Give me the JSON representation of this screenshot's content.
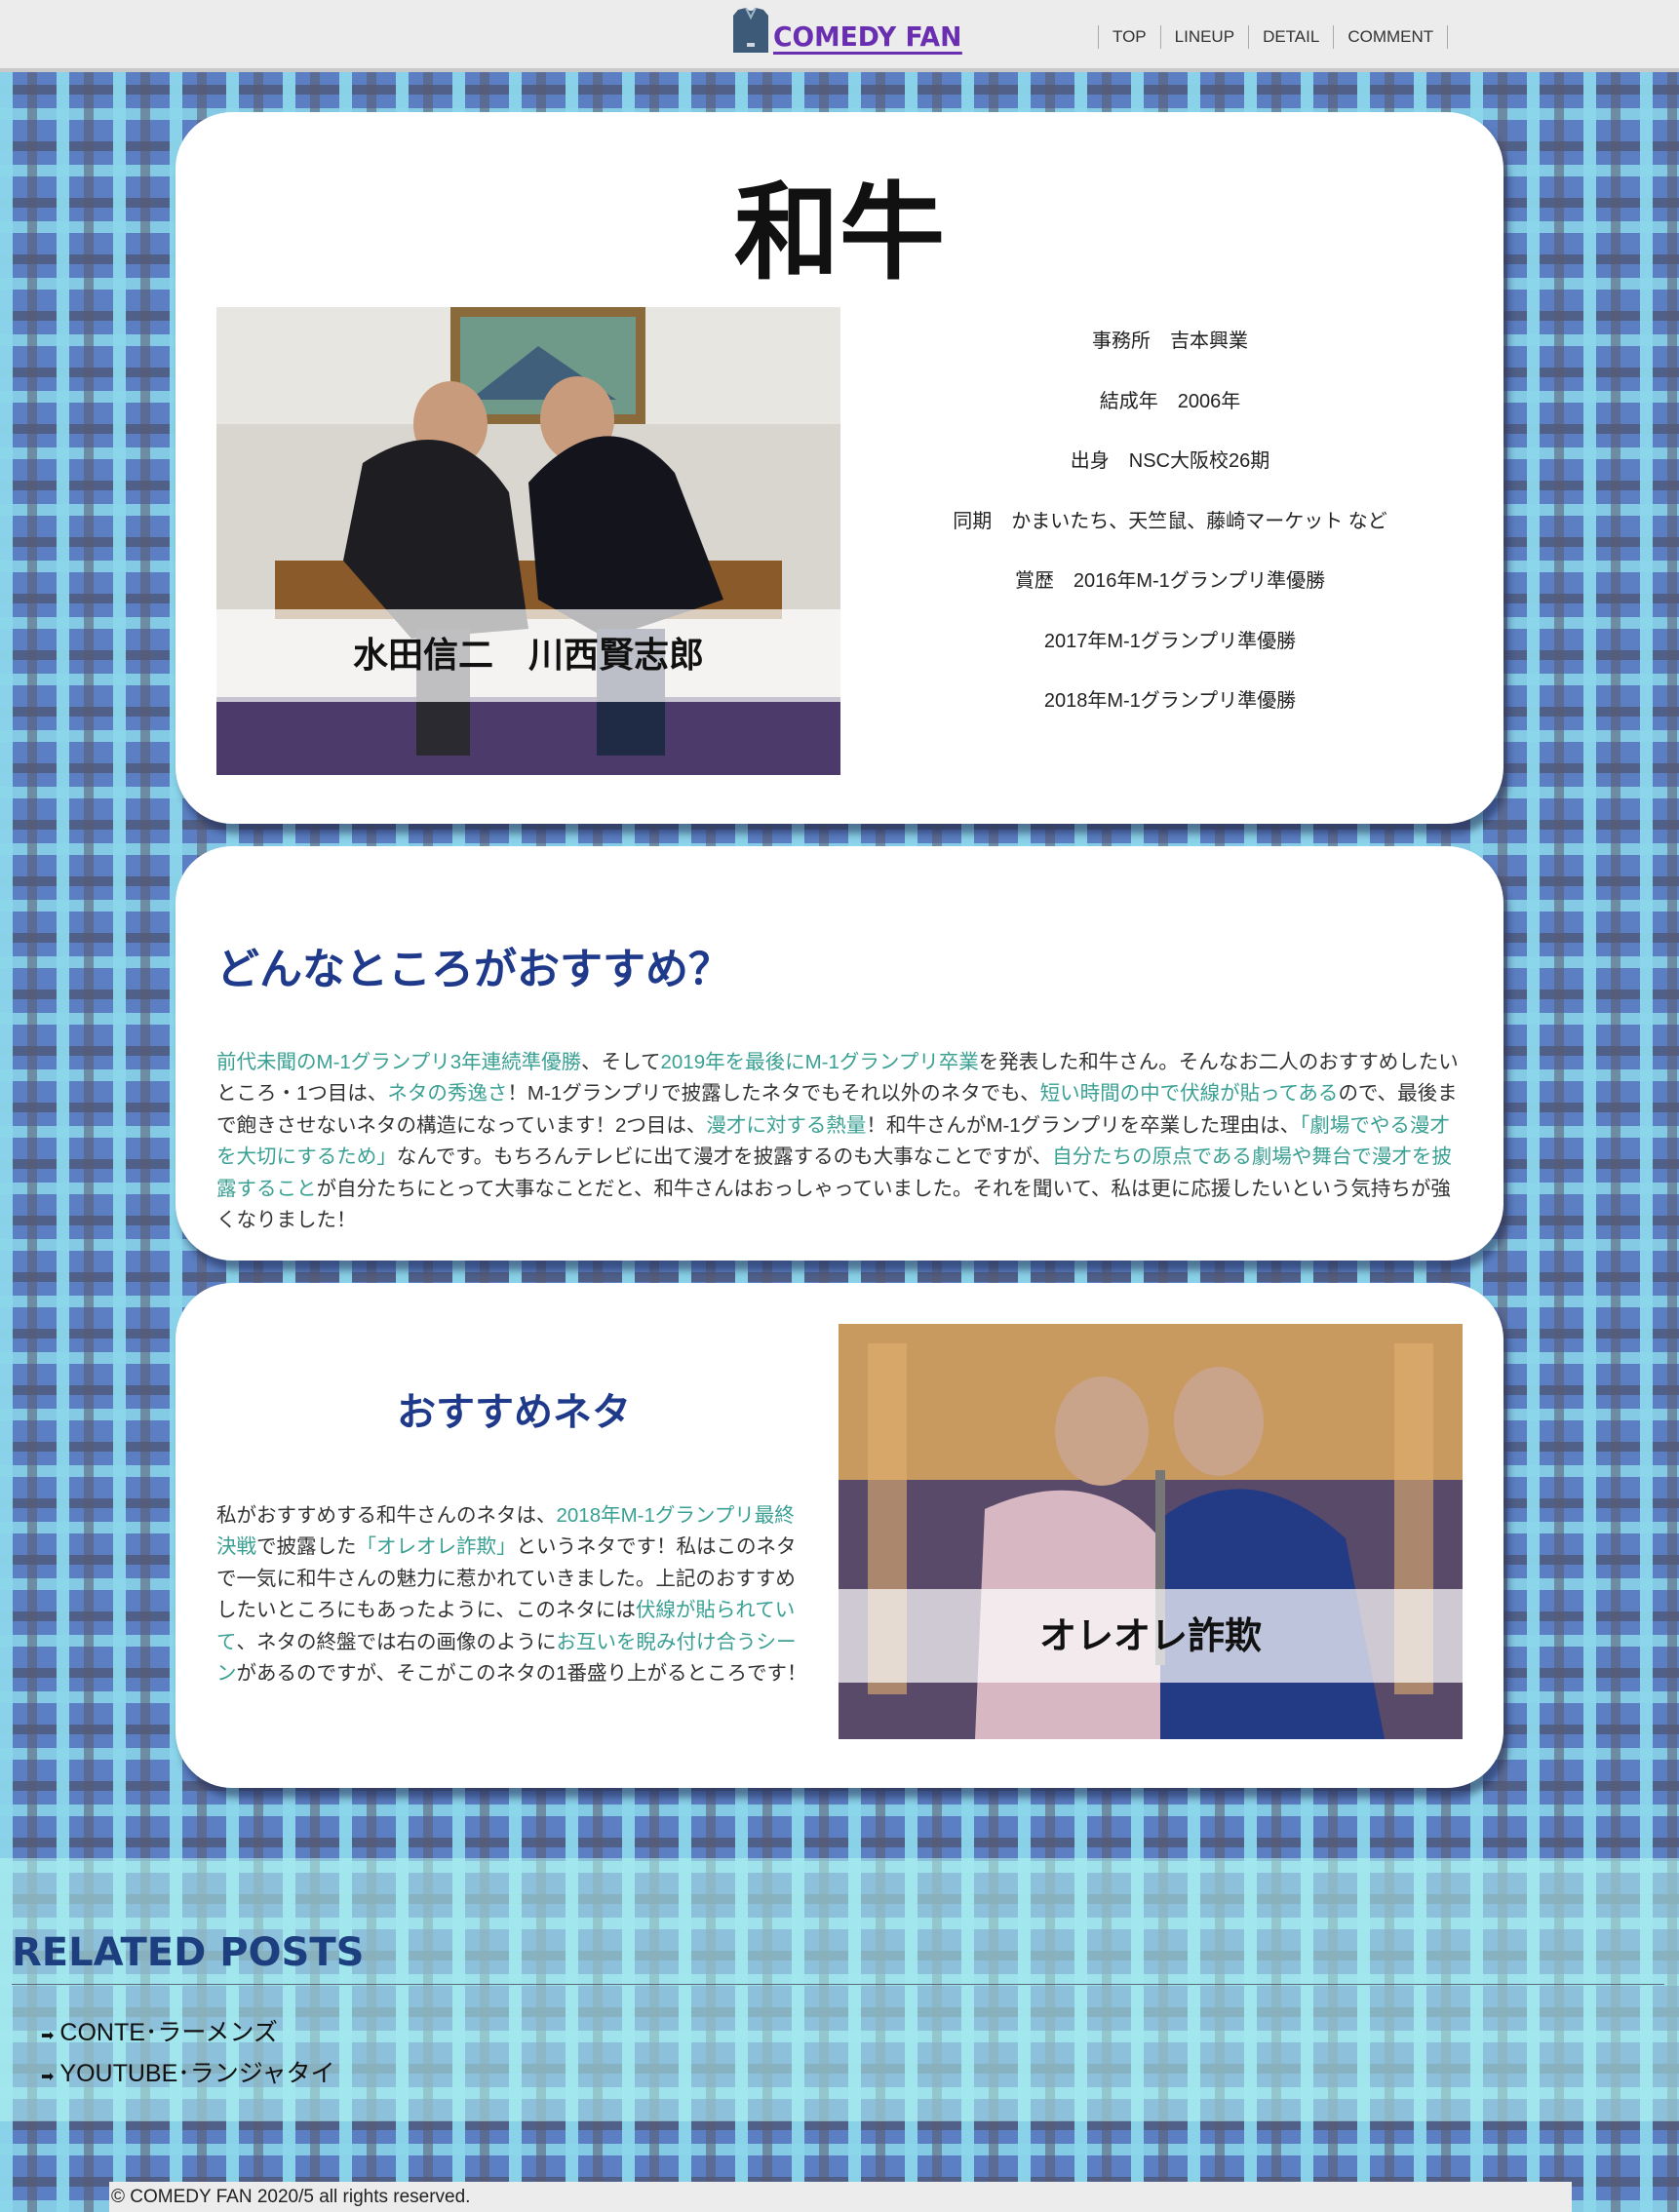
{
  "header": {
    "logo_text": "COMEDY FAN",
    "logo_icon": "shirt-icon",
    "nav": [
      "TOP",
      "LINEUP",
      "DETAIL",
      "COMMENT"
    ]
  },
  "profile": {
    "name": "和牛",
    "photo_caption": "水田信二　川西賢志郎",
    "info": [
      "事務所　吉本興業",
      "結成年　2006年",
      "出身　NSC大阪校26期",
      "同期　かまいたち、天竺鼠、藤崎マーケット など",
      "賞歴　2016年M-1グランプリ準優勝",
      "2017年M-1グランプリ準優勝",
      "2018年M-1グランプリ準優勝"
    ]
  },
  "recommend": {
    "heading": "どんなところがおすすめ？",
    "segments": [
      {
        "text": "前代未聞のM-1グランプリ3年連続準優勝",
        "hl": true
      },
      {
        "text": "、そして",
        "hl": false
      },
      {
        "text": "2019年を最後にM-1グランプリ卒業",
        "hl": true
      },
      {
        "text": "を発表した和牛さん。そんなお二人のおすすめしたいところ・1つ目は、",
        "hl": false
      },
      {
        "text": "ネタの秀逸さ",
        "hl": true
      },
      {
        "text": "！M-1グランプリで披露したネタでもそれ以外のネタでも、",
        "hl": false
      },
      {
        "text": "短い時間の中で伏線が貼ってある",
        "hl": true
      },
      {
        "text": "ので、最後まで飽きさせないネタの構造になっています！2つ目は、",
        "hl": false
      },
      {
        "text": "漫才に対する熱量",
        "hl": true
      },
      {
        "text": "！和牛さんがM-1グランプリを卒業した理由は、",
        "hl": false
      },
      {
        "text": "「劇場でやる漫才を大切にするため」",
        "hl": true
      },
      {
        "text": "なんです。もちろんテレビに出て漫才を披露するのも大事なことですが、",
        "hl": false
      },
      {
        "text": "自分たちの原点である劇場や舞台で漫才を披露すること",
        "hl": true
      },
      {
        "text": "が自分たちにとって大事なことだと、和牛さんはおっしゃっていました。それを聞いて、私は更に応援したいという気持ちが強くなりました！",
        "hl": false
      }
    ]
  },
  "neta": {
    "heading": "おすすめネタ",
    "photo_caption": "オレオレ詐欺",
    "segments": [
      {
        "text": "私がおすすめする和牛さんのネタは、",
        "hl": false
      },
      {
        "text": "2018年M-1グランプリ最終決戦",
        "hl": true
      },
      {
        "text": "で披露した",
        "hl": false
      },
      {
        "text": "「オレオレ詐欺」",
        "hl": true
      },
      {
        "text": "というネタです！私はこのネタで一気に和牛さんの魅力に惹かれていきました。上記のおすすめしたいところにもあったように、このネタには",
        "hl": false
      },
      {
        "text": "伏線が貼られていて",
        "hl": true
      },
      {
        "text": "、ネタの終盤では右の画像のように",
        "hl": false
      },
      {
        "text": "お互いを睨み付け合うシーン",
        "hl": true
      },
      {
        "text": "があるのですが、そこがこのネタの1番盛り上がるところです！",
        "hl": false
      }
    ]
  },
  "related": {
    "title": "RELATED POSTS",
    "items": [
      "CONTE･ラーメンズ",
      "YOUTUBE･ランジャタイ"
    ]
  },
  "footer": {
    "copyright": "© COMEDY FAN 2020/5 all rights reserved."
  },
  "colors": {
    "highlight": "#3aa093",
    "heading": "#1f3a8a",
    "logo": "#6a2fb0"
  }
}
